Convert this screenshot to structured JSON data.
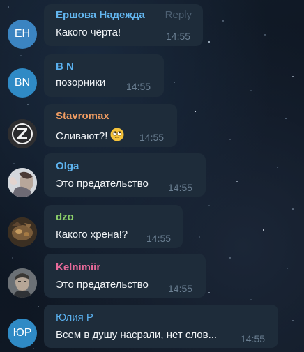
{
  "colors": {
    "bubble_bg": "#1e2c3a",
    "text": "#f0f3f6",
    "time": "#6b7f92"
  },
  "messages": [
    {
      "sender": "Ершова Надежда",
      "sender_color": "#63b6ef",
      "avatar_initials": "ЕН",
      "avatar_color": "#3b84c1",
      "text": "Какого чёрта!",
      "time": "14:55",
      "reply_label": "Reply"
    },
    {
      "sender": "B N",
      "sender_color": "#5ab0ee",
      "avatar_initials": "BN",
      "avatar_color": "#2f8ac5",
      "text": "позорники",
      "time": "14:55"
    },
    {
      "sender": "Stavromax",
      "sender_color": "#ef9c62",
      "avatar_icon": "z-logo-icon",
      "text": "Сливают?!",
      "emoji": "rolling-eyes-emoji",
      "time": "14:55"
    },
    {
      "sender": "Olga",
      "sender_color": "#5eb3ee",
      "avatar_icon": "photo-avatar",
      "text": "Это предательство",
      "time": "14:55"
    },
    {
      "sender": "dzo",
      "sender_color": "#8cd06a",
      "avatar_icon": "photo-avatar",
      "text": "Какого хрена!?",
      "time": "14:55"
    },
    {
      "sender": "Kelnimiir",
      "sender_color": "#e86a9a",
      "avatar_icon": "photo-avatar",
      "text": "Это предательство",
      "time": "14:55"
    },
    {
      "sender": "Юлия Р",
      "sender_color": "#5ab0ee",
      "avatar_initials": "ЮР",
      "avatar_color": "#2f8ac5",
      "text": "Всем в душу насрали, нет слов...",
      "time": "14:55"
    }
  ]
}
